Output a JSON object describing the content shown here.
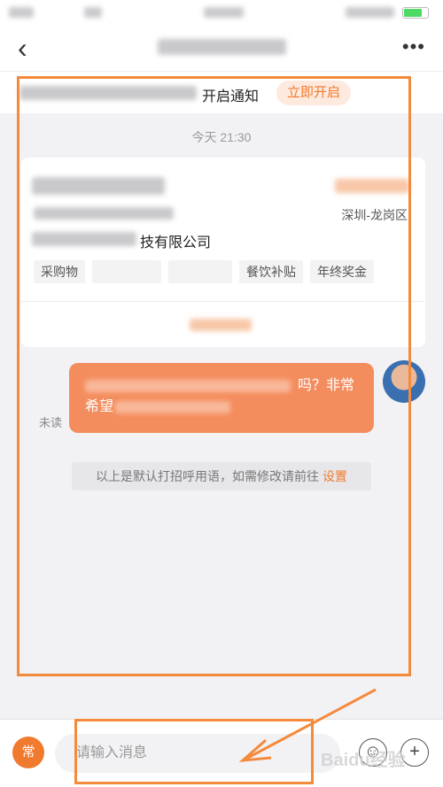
{
  "notice": {
    "text": "开启通知",
    "button": "立即开启"
  },
  "chat": {
    "time": "今天 21:30",
    "job_card": {
      "city": "深圳-龙岗区",
      "company_suffix": "技有限公司",
      "tags": [
        "采购物",
        "餐饮补贴",
        "年终奖金"
      ]
    },
    "message": {
      "text_line1": "吗？非常",
      "text_line2": "希望",
      "status": "未读"
    },
    "hint": {
      "text": "以上是默认打招呼用语，如需修改请前往",
      "link": "设置"
    }
  },
  "input_bar": {
    "common_label": "常",
    "placeholder": "请输入消息",
    "emoji_icon": "☺",
    "plus_icon": "+"
  },
  "watermark": "Baidu经验"
}
